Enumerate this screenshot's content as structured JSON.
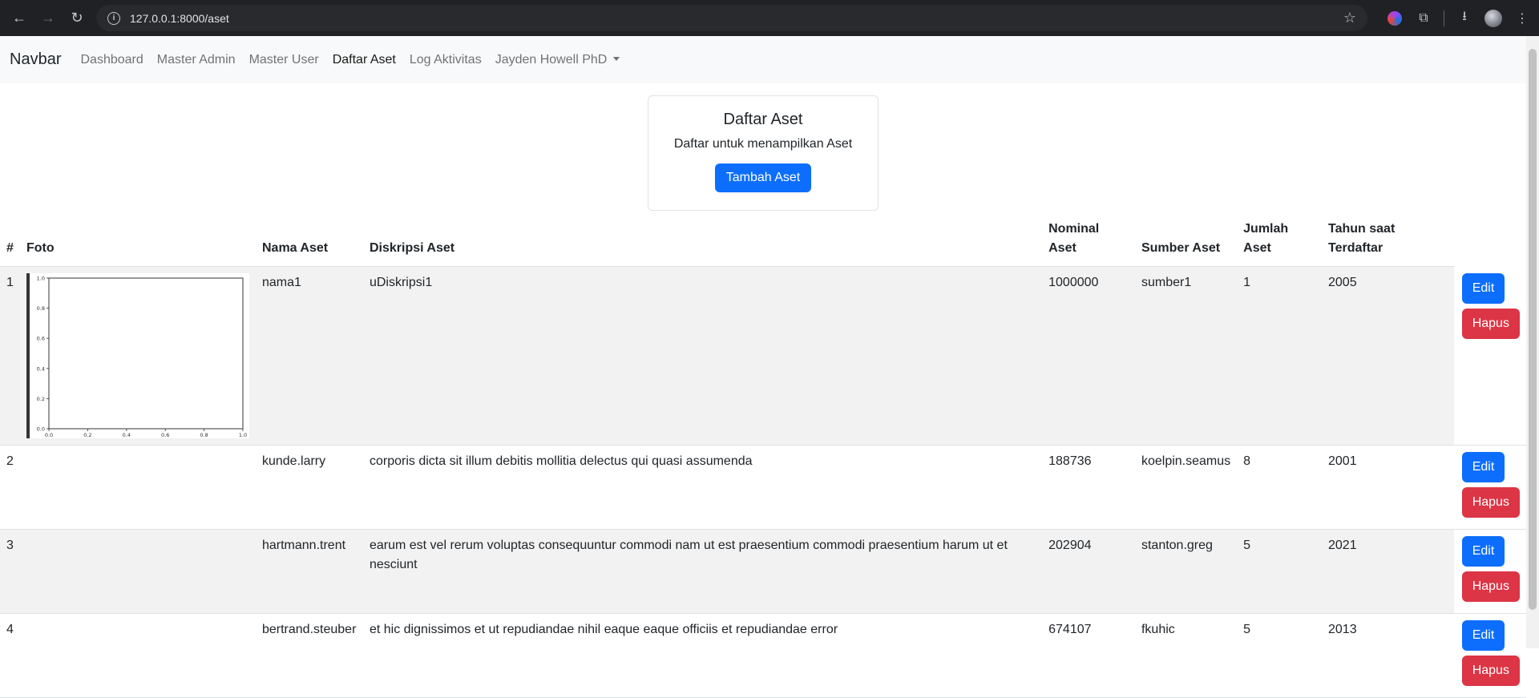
{
  "browser": {
    "url": "127.0.0.1:8000/aset"
  },
  "navbar": {
    "brand": "Navbar",
    "links": [
      "Dashboard",
      "Master Admin",
      "Master User",
      "Daftar Aset",
      "Log Aktivitas"
    ],
    "user": "Jayden Howell PhD"
  },
  "card": {
    "title": "Daftar Aset",
    "text": "Daftar untuk menampilkan Aset",
    "button": "Tambah Aset"
  },
  "table": {
    "headers": {
      "no": "#",
      "foto": "Foto",
      "nama": "Nama Aset",
      "diskripsi": "Diskripsi Aset",
      "nominal_1": "Nominal",
      "nominal_2": "Aset",
      "sumber": "Sumber Aset",
      "jumlah_1": "Jumlah",
      "jumlah_2": "Aset",
      "tahun_1": "Tahun saat",
      "tahun_2": "Terdaftar"
    },
    "rows": [
      {
        "no": "1",
        "nama": "nama1",
        "diskripsi": "uDiskripsi1",
        "nominal": "1000000",
        "sumber": "sumber1",
        "jumlah": "1",
        "tahun": "2005"
      },
      {
        "no": "2",
        "nama": "kunde.larry",
        "diskripsi": "corporis dicta sit illum debitis mollitia delectus qui quasi assumenda",
        "nominal": "188736",
        "sumber": "koelpin.seamus",
        "jumlah": "8",
        "tahun": "2001"
      },
      {
        "no": "3",
        "nama": "hartmann.trent",
        "diskripsi": "earum est vel rerum voluptas consequuntur commodi nam ut est praesentium commodi praesentium harum ut et nesciunt",
        "nominal": "202904",
        "sumber": "stanton.greg",
        "jumlah": "5",
        "tahun": "2021"
      },
      {
        "no": "4",
        "nama": "bertrand.steuber",
        "diskripsi": "et hic dignissimos et ut repudiandae nihil eaque eaque officiis et repudiandae error",
        "nominal": "674107",
        "sumber": "fkuhic",
        "jumlah": "5",
        "tahun": "2013"
      }
    ],
    "edit_label": "Edit",
    "delete_label": "Hapus"
  },
  "thumbnail": {
    "y_ticks": [
      "1.0",
      "0.8",
      "0.6",
      "0.4",
      "0.2",
      "0.0"
    ],
    "x_ticks": [
      "0.0",
      "0.2",
      "0.4",
      "0.6",
      "0.8",
      "1.0"
    ]
  }
}
